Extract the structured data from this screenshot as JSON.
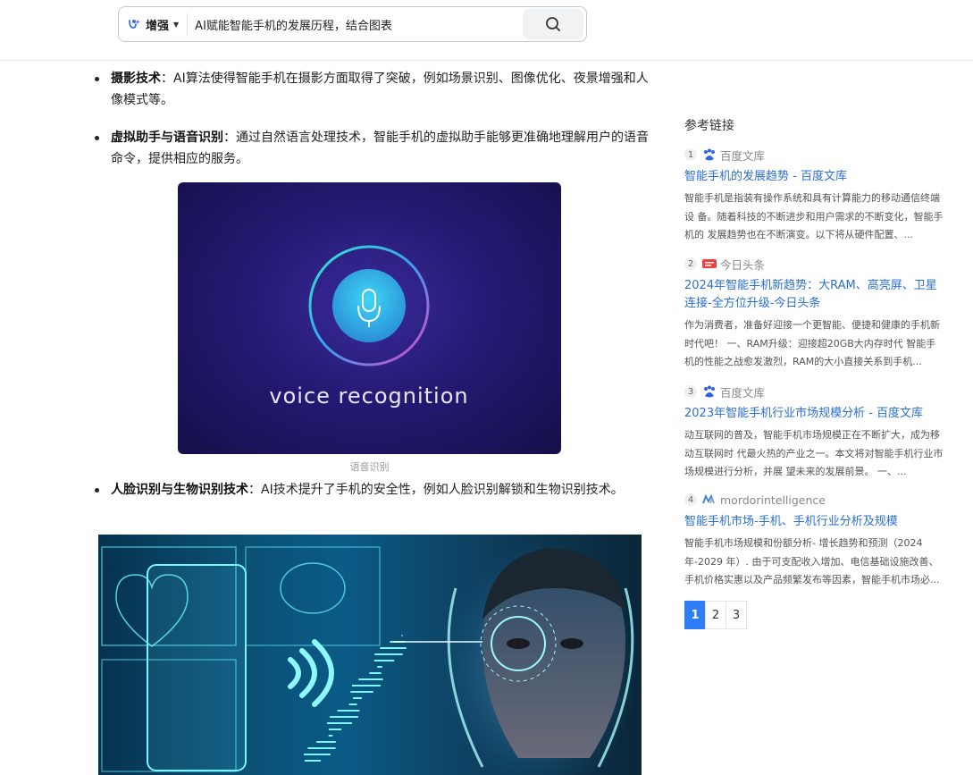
{
  "search": {
    "mode_label": "增强",
    "query": "AI赋能智能手机的发展历程，结合图表"
  },
  "article": {
    "bullets": [
      {
        "term": "摄影技术",
        "text": "：AI算法使得智能手机在摄影方面取得了突破，例如场景识别、图像优化、夜景增强和人像模式等。"
      },
      {
        "term": "虚拟助手与语音识别",
        "text": "：通过自然语言处理技术，智能手机的虚拟助手能够更准确地理解用户的语音命令，提供相应的服务。"
      },
      {
        "term": "人脸识别与生物识别技术",
        "text": "：AI技术提升了手机的安全性，例如人脸识别解锁和生物识别技术。"
      }
    ],
    "voice_image_text": "voice recognition",
    "voice_caption": "语音识别"
  },
  "sidebar": {
    "title": "参考链接",
    "refs": [
      {
        "num": "1",
        "source": "百度文库",
        "source_icon": "baidu-paw-icon",
        "title": "智能手机的发展趋势 - 百度文库",
        "desc": "智能手机是指装有操作系统和具有计算能力的移动通信终端设 备。随着科技的不断进步和用户需求的不断变化，智能手机的 发展趋势也在不断演变。以下将从硬件配置、..."
      },
      {
        "num": "2",
        "source": "今日头条",
        "source_icon": "toutiao-icon",
        "title": "2024年智能手机新趋势：大RAM、高亮屏、卫星连接-全方位升级-今日头条",
        "desc": "作为消费者，准备好迎接一个更智能、便捷和健康的手机新时代吧！ 一、RAM升级：迎接超20GB大内存时代 智能手机的性能之战愈发激烈，RAM的大小直接关系到手机..."
      },
      {
        "num": "3",
        "source": "百度文库",
        "source_icon": "baidu-paw-icon",
        "title": "2023年智能手机行业市场规模分析 - 百度文库",
        "desc": "动互联网的普及，智能手机市场规模正在不断扩大，成为移动互联网时 代最火热的产业之一。本文将对智能手机行业市场规模进行分析，并展 望未来的发展前景。 一、..."
      },
      {
        "num": "4",
        "source": "mordorintelligence",
        "source_icon": "mordor-icon",
        "title": "智能手机市场-手机、手机行业分析及规模",
        "desc": "智能手机市场规模和份额分析- 增长趋势和预测（2024 年-2029 年）. 由于可支配收入增加、电信基础设施改善、手机价格实惠以及产品频繁发布等因素，智能手机市场必..."
      }
    ],
    "pages": [
      "1",
      "2",
      "3"
    ],
    "active_page": "1"
  },
  "colors": {
    "link": "#2b6fd6",
    "pager_active": "#2f7ef7",
    "voice_bg": "#241a73",
    "wave_pink": "#e040c8",
    "wave_cyan": "#35d6ef"
  }
}
